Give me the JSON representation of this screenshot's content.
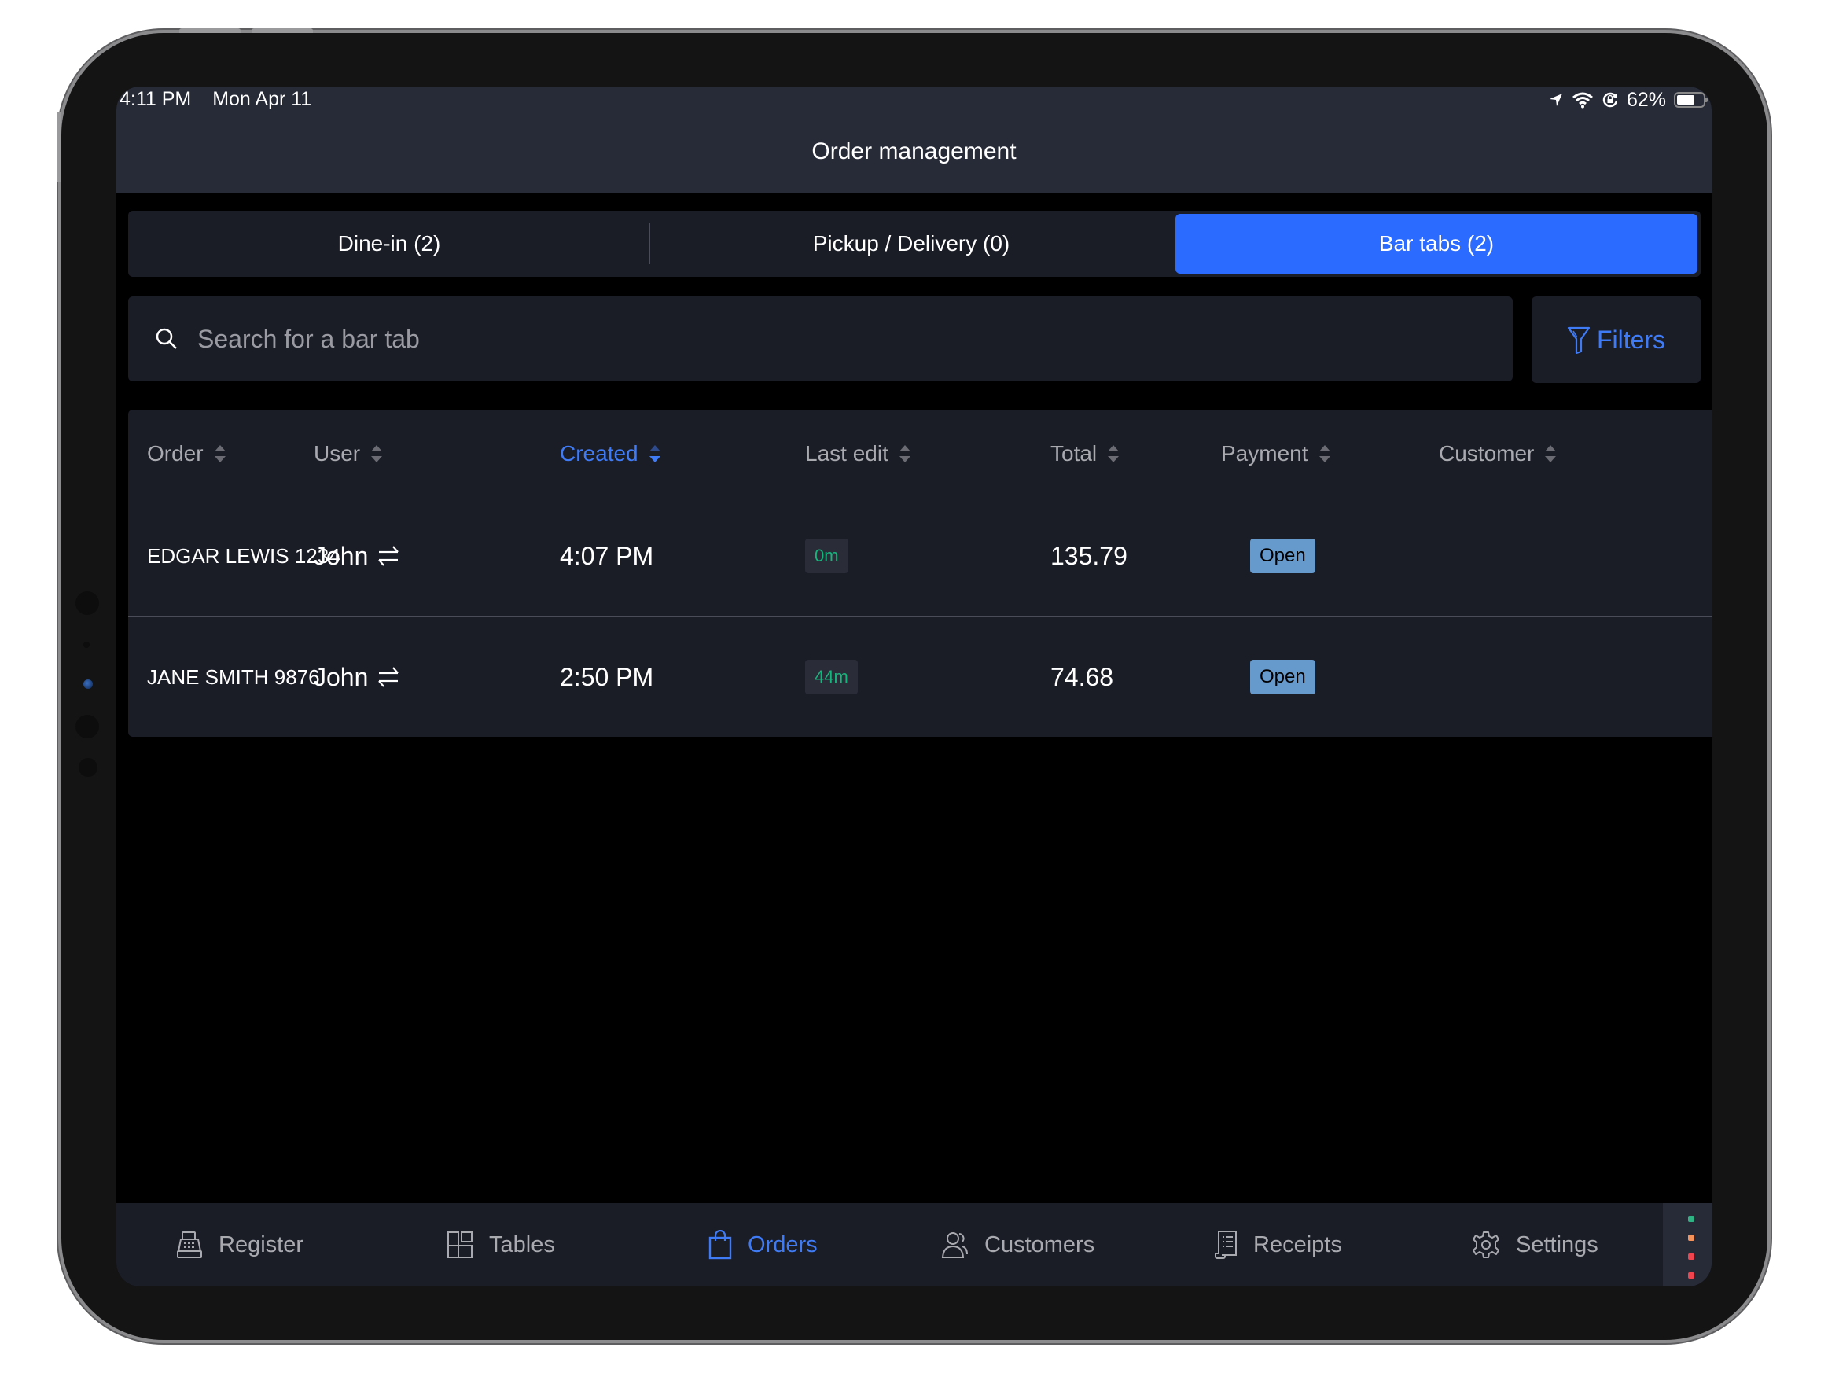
{
  "status_bar": {
    "time": "4:11 PM",
    "date": "Mon Apr 11",
    "battery": "62%",
    "icons": [
      "location-arrow-icon",
      "wifi-icon",
      "rotation-lock-icon",
      "battery-icon"
    ]
  },
  "header": {
    "title": "Order management"
  },
  "segments": [
    {
      "label": "Dine-in (2)",
      "active": false
    },
    {
      "label": "Pickup / Delivery (0)",
      "active": false
    },
    {
      "label": "Bar tabs (2)",
      "active": true
    }
  ],
  "search": {
    "placeholder": "Search for a bar tab",
    "value": "",
    "icon": "search-icon"
  },
  "filters": {
    "label": "Filters",
    "icon": "funnel-icon"
  },
  "table": {
    "columns": [
      "Order",
      "User",
      "Created",
      "Last edit",
      "Total",
      "Payment",
      "Customer"
    ],
    "sorted_column": "Created",
    "rows": [
      {
        "order": "EDGAR LEWIS 1234",
        "user": "John",
        "created": "4:07 PM",
        "last_edit": "0m",
        "total": "135.79",
        "payment": "Open",
        "customer": ""
      },
      {
        "order": "JANE SMITH 9876",
        "user": "John",
        "created": "2:50 PM",
        "last_edit": "44m",
        "total": "74.68",
        "payment": "Open",
        "customer": ""
      }
    ]
  },
  "bottom_nav": [
    {
      "label": "Register",
      "icon": "cash-register-icon",
      "active": false
    },
    {
      "label": "Tables",
      "icon": "tables-grid-icon",
      "active": false
    },
    {
      "label": "Orders",
      "icon": "shopping-bag-icon",
      "active": true
    },
    {
      "label": "Customers",
      "icon": "customers-icon",
      "active": false
    },
    {
      "label": "Receipts",
      "icon": "receipt-icon",
      "active": false
    },
    {
      "label": "Settings",
      "icon": "gear-icon",
      "active": false
    }
  ],
  "status_indicators": [
    {
      "name": "indicator-1",
      "color": "#2fb385"
    },
    {
      "name": "indicator-2",
      "color": "#f5935a"
    },
    {
      "name": "indicator-3",
      "color": "#f0454f"
    },
    {
      "name": "indicator-4",
      "color": "#f0454f"
    }
  ],
  "colors": {
    "accent": "#2b6bff",
    "link": "#3f7bf5",
    "edit_green": "#17b57d",
    "payment_badge": "#6699cc"
  }
}
